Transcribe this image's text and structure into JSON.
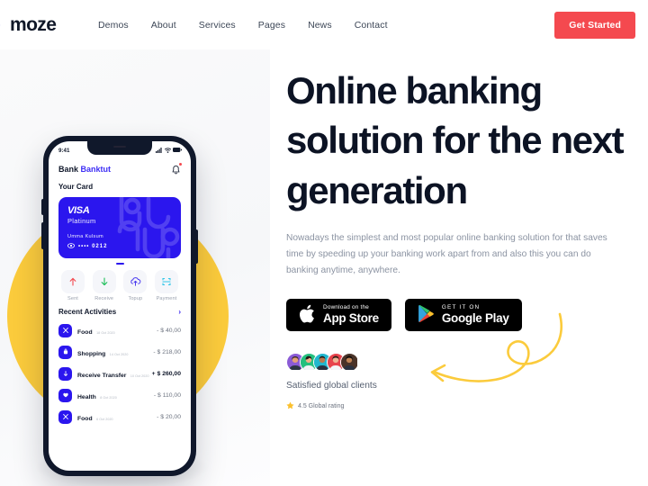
{
  "header": {
    "logo_text": "moze",
    "logo_mark_icon": "angular-x-mark-icon",
    "nav": [
      {
        "label": "Demos"
      },
      {
        "label": "About"
      },
      {
        "label": "Services"
      },
      {
        "label": "Pages"
      },
      {
        "label": "News"
      },
      {
        "label": "Contact"
      }
    ],
    "cta_label": "Get Started",
    "cta_color": "#F4494F"
  },
  "phone": {
    "status": {
      "time": "9:41",
      "signal_icon": "cellular-signal-icon",
      "wifi_icon": "wifi-icon",
      "battery_icon": "battery-icon"
    },
    "app": {
      "title_prefix": "Bank ",
      "title_accent": "Banktut",
      "bell_icon": "notification-bell-icon",
      "section_label": "Your Card"
    },
    "card": {
      "brand": "VISA",
      "tier": "Platinum",
      "holder": "Umma Kulsum",
      "number": "•••• 0212",
      "chip_icon": "card-chip-icon",
      "bg_color": "#2B16EE"
    },
    "actions": [
      {
        "label": "Sent",
        "icon": "arrow-up-icon",
        "color": "#F4494F"
      },
      {
        "label": "Receive",
        "icon": "arrow-down-icon",
        "color": "#1FBF5B"
      },
      {
        "label": "Topup",
        "icon": "cloud-upload-icon",
        "color": "#4A3AF0"
      },
      {
        "label": "Payment",
        "icon": "scan-frame-icon",
        "color": "#34C6E8"
      }
    ],
    "recent": {
      "title": "Recent Activities",
      "chevron_icon": "chevron-right-icon"
    },
    "transactions": [
      {
        "name": "Food",
        "date": "18 Oct 2020",
        "amount": "- $ 40,00",
        "icon": "cutlery-icon",
        "positive": false
      },
      {
        "name": "Shopping",
        "date": "14 Oct 2020",
        "amount": "- $ 218,00",
        "icon": "shopping-bag-icon",
        "positive": false
      },
      {
        "name": "Receive Transfer",
        "date": "10 Oct 2020",
        "amount": "+ $ 260,00",
        "icon": "arrow-down-icon",
        "positive": true
      },
      {
        "name": "Health",
        "date": "8 Oct 2020",
        "amount": "- $ 110,00",
        "icon": "heart-pulse-icon",
        "positive": false
      },
      {
        "name": "Food",
        "date": "6 Oct 2020",
        "amount": "- $ 20,00",
        "icon": "cutlery-icon",
        "positive": false
      }
    ]
  },
  "hero": {
    "headline": "Online banking solution for the next generation",
    "paragraph": "Nowadays the simplest and most popular online banking solution for that saves time by speeding up your banking work apart from and also this you can do banking anytime, anywhere.",
    "stores": [
      {
        "icon": "apple-logo-icon",
        "small": "Download on the",
        "big": "App Store"
      },
      {
        "icon": "google-play-icon",
        "small": "GET IT ON",
        "big": "Google Play"
      }
    ],
    "clients": {
      "label": "Satisfied global clients",
      "star_icon": "star-icon",
      "rating_text": "4.5 Global rating",
      "avatars": [
        {
          "bg": "#8B5BD6"
        },
        {
          "bg": "#23C07E"
        },
        {
          "bg": "#22B7CE"
        },
        {
          "bg": "#E8434C"
        },
        {
          "bg": "#4A3328"
        }
      ]
    },
    "arrow_icon": "curly-arrow-left-icon",
    "arrow_color": "#FBCB3C"
  }
}
